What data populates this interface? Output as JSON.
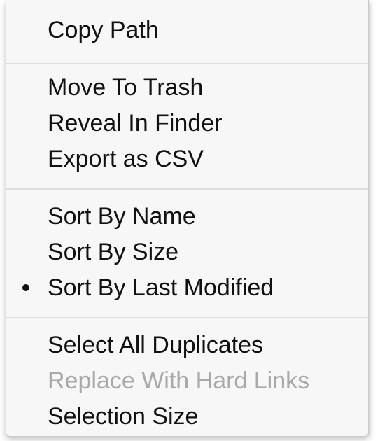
{
  "menu": {
    "sections": [
      {
        "items": [
          {
            "label": "Copy Path",
            "enabled": true
          }
        ]
      },
      {
        "items": [
          {
            "label": "Move To Trash",
            "enabled": true
          },
          {
            "label": "Reveal In Finder",
            "enabled": true
          },
          {
            "label": "Export as CSV",
            "enabled": true
          }
        ]
      },
      {
        "items": [
          {
            "label": "Sort By Name",
            "enabled": true
          },
          {
            "label": "Sort By Size",
            "enabled": true
          },
          {
            "label": "Sort By Last Modified",
            "enabled": true,
            "checked": true,
            "check_icon": "bullet-icon"
          }
        ]
      },
      {
        "items": [
          {
            "label": "Select All Duplicates",
            "enabled": true
          },
          {
            "label": "Replace With Hard Links",
            "enabled": false
          },
          {
            "label": "Selection Size",
            "enabled": true
          }
        ]
      }
    ]
  }
}
